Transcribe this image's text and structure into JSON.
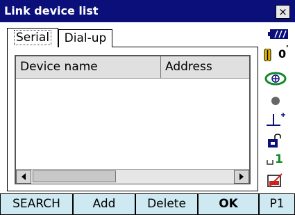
{
  "window": {
    "title": "Link device list",
    "close_symbol": "×"
  },
  "tabs": [
    {
      "label": "Serial",
      "active": true
    },
    {
      "label": "Dial-up",
      "active": false
    }
  ],
  "list": {
    "columns": [
      "Device name",
      "Address"
    ],
    "rows": []
  },
  "status": {
    "battery_icon": "battery-icon",
    "tilt_value": "0",
    "prism_icon": "prism-target-icon",
    "laser_icon": "laser-dot-icon",
    "plummet_icon": "laser-plummet-icon",
    "input_mode_icon": "input-mode-icon",
    "input_mode_value": "1",
    "memory_icon": "memory-card-icon"
  },
  "softkeys": [
    "SEARCH",
    "Add",
    "Delete",
    "OK",
    "P1"
  ],
  "colors": {
    "title_bar": "#0a0f7a",
    "softkey_bg": "#cfe9f2",
    "header_bg": "#e0e0e0",
    "battery": "#0a0f7a",
    "prism": "#118a2a"
  }
}
